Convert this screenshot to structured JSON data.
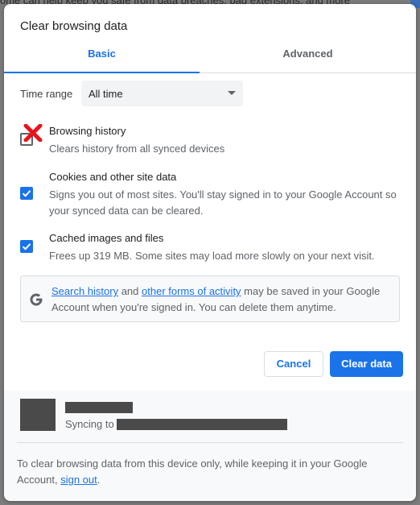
{
  "background": {
    "top_text": "ome can help keep you safe from data breaches, bad extensions, and more"
  },
  "dialog": {
    "title": "Clear browsing data",
    "tabs": [
      {
        "label": "Basic",
        "active": true
      },
      {
        "label": "Advanced",
        "active": false
      }
    ],
    "time_range": {
      "label": "Time range",
      "selected": "All time"
    },
    "options": [
      {
        "title": "Browsing history",
        "description": "Clears history from all synced devices",
        "checked": false
      },
      {
        "title": "Cookies and other site data",
        "description": "Signs you out of most sites. You'll stay signed in to your Google Account so your synced data can be cleared.",
        "checked": true
      },
      {
        "title": "Cached images and files",
        "description": "Frees up 319 MB. Some sites may load more slowly on your next visit.",
        "checked": true
      }
    ],
    "info": {
      "link1": "Search history",
      "text1": " and ",
      "link2": "other forms of activity",
      "text2": " may be saved in your Google Account when you're signed in. You can delete them anytime."
    },
    "buttons": {
      "cancel": "Cancel",
      "clear": "Clear data"
    },
    "footer": {
      "syncing_label": "Syncing to",
      "text_before": "To clear browsing data from this device only, while keeping it in your Google Account, ",
      "link": "sign out",
      "text_after": "."
    }
  },
  "colors": {
    "accent": "#1a73e8",
    "red_x": "#e8141c"
  }
}
